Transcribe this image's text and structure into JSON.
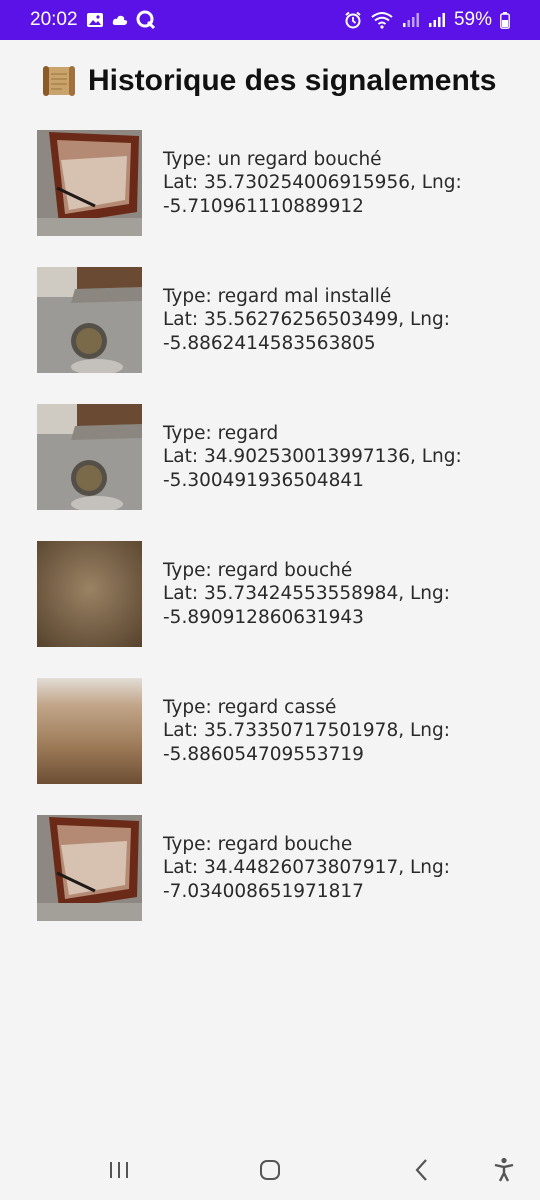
{
  "status_bar": {
    "time": "20:02",
    "battery": "59%",
    "icons": [
      "gallery-icon",
      "cloud-icon",
      "q-app-icon",
      "alarm-icon",
      "wifi-icon",
      "signal-icon",
      "signal-icon",
      "battery-icon"
    ]
  },
  "header": {
    "icon": "scroll-icon",
    "title": "Historique des signalements"
  },
  "reports": [
    {
      "type": "Type: un regard bouché",
      "coords": "Lat: 35.730254006915956, Lng:",
      "lng": "-5.710961110889912",
      "thumb": "manhole-photo"
    },
    {
      "type": "Type: regard mal installé",
      "coords": "Lat: 35.56276256503499, Lng:",
      "lng": "-5.8862414583563805",
      "thumb": "street-drain-photo"
    },
    {
      "type": "Type: regard",
      "coords": "Lat: 34.902530013997136, Lng:",
      "lng": "-5.300491936504841",
      "thumb": "street-drain-photo"
    },
    {
      "type": "Type: regard bouché",
      "coords": "Lat: 35.73424553558984, Lng:",
      "lng": "-5.890912860631943",
      "thumb": "blurry-brown-photo"
    },
    {
      "type": "Type: regard cassé",
      "coords": "Lat: 35.73350717501978, Lng:",
      "lng": "-5.886054709553719",
      "thumb": "blurry-beige-photo"
    },
    {
      "type": "Type: regard bouche",
      "coords": "Lat: 34.44826073807917, Lng:",
      "lng": "-7.034008651971817",
      "thumb": "manhole-photo"
    }
  ],
  "nav_bar": {
    "icons": [
      "recent-apps-icon",
      "home-icon",
      "back-icon",
      "accessibility-icon"
    ]
  },
  "colors": {
    "status_bar_bg": "#5b12e6",
    "background": "#f4f4f4",
    "title_text": "#111111",
    "body_text": "#2a2a2a"
  }
}
